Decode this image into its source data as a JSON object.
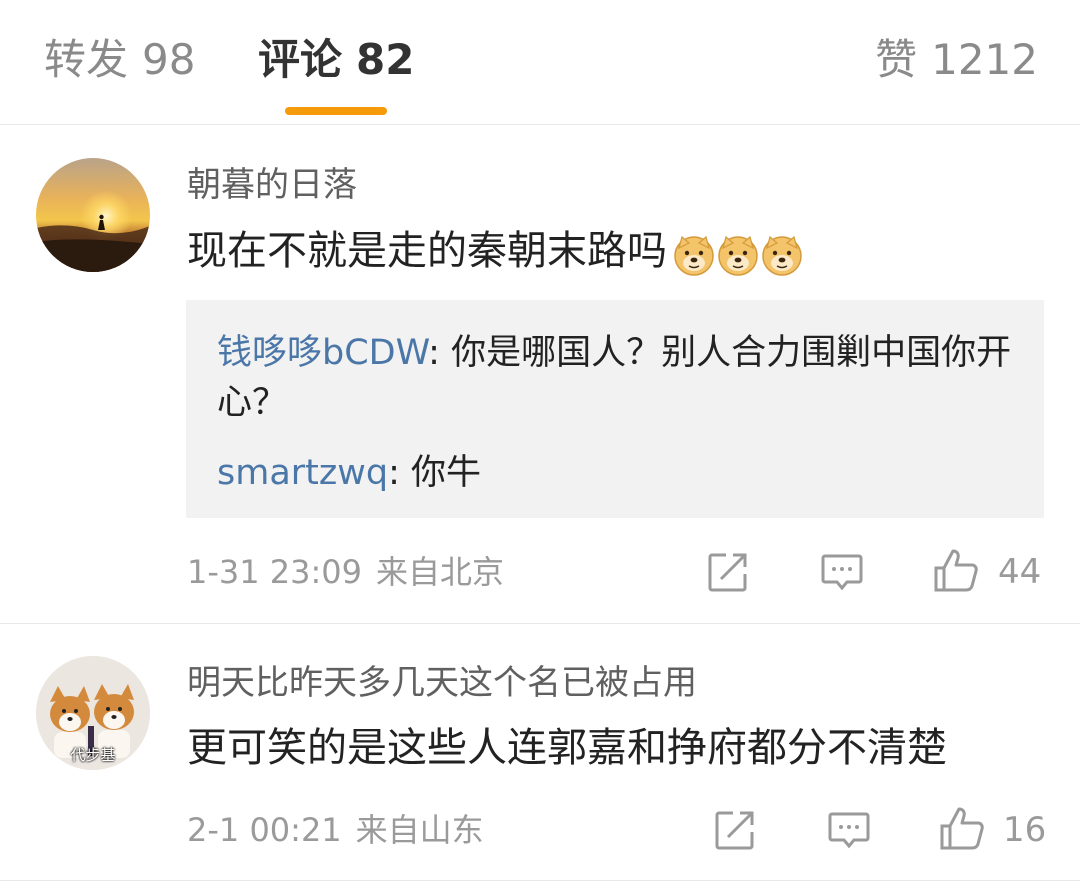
{
  "tabs": {
    "repost": {
      "label": "转发",
      "count": "98"
    },
    "comment": {
      "label": "评论",
      "count": "82"
    },
    "like": {
      "label": "赞",
      "count": "1212"
    }
  },
  "accent_color": "#f59a0b",
  "link_color": "#4b77a8",
  "comments": [
    {
      "username": "朝暮的日落",
      "text": "现在不就是走的秦朝末路吗",
      "emoji": [
        "doge-emoji",
        "doge-emoji",
        "doge-emoji"
      ],
      "replies": [
        {
          "user": "钱哆哆bCDW",
          "sep": ": ",
          "text": "你是哪国人？别人合力围剿中国你开心？"
        },
        {
          "user": "smartzwq",
          "sep": ": ",
          "text": "你牛"
        }
      ],
      "time": "1-31 23:09",
      "source": "来自北京",
      "likes": "44"
    },
    {
      "username": "明天比昨天多几天这个名已被占用",
      "text": "更可笑的是这些人连郭嘉和挣府都分不清楚",
      "avatar_caption": "代步基",
      "time": "2-1 00:21",
      "source": "来自山东",
      "likes": "16"
    }
  ]
}
